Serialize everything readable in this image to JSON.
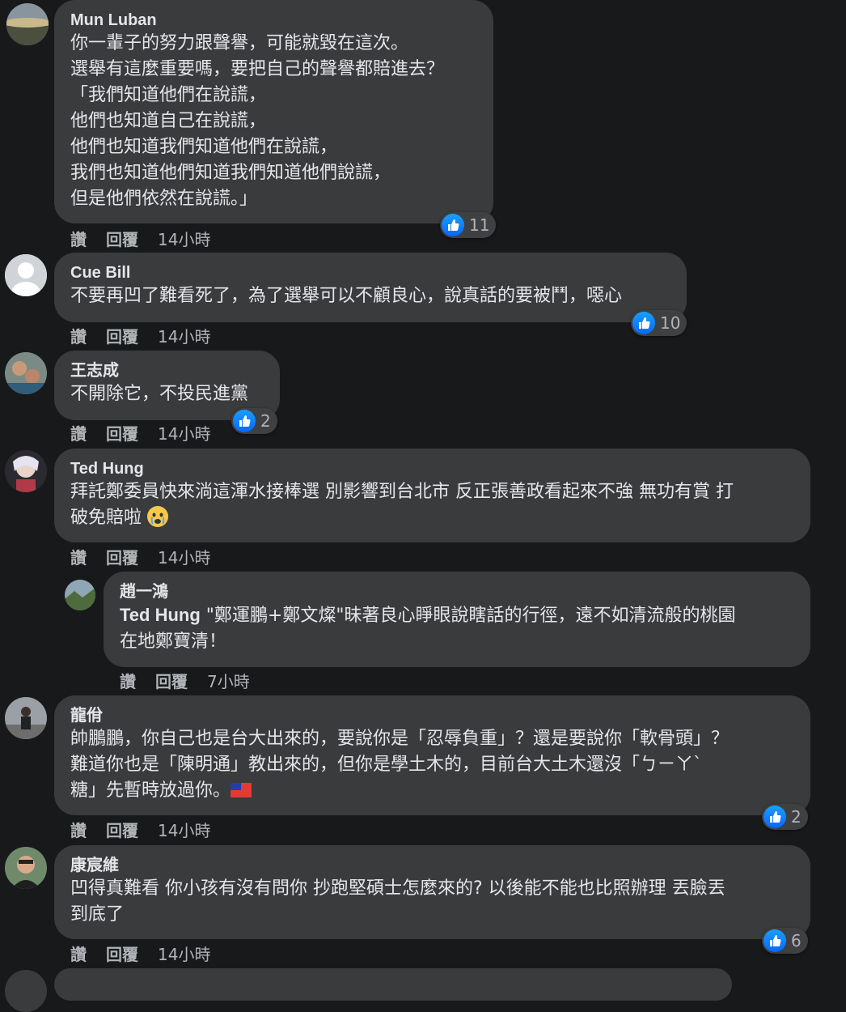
{
  "actions": {
    "like": "讚",
    "reply": "回覆"
  },
  "comments": [
    {
      "author": "Mun Luban",
      "lines": [
        "你一輩子的努力跟聲譽，可能就毀在這次。",
        "選舉有這麼重要嗎，要把自己的聲譽都賠進去？",
        "「我們知道他們在說謊，",
        "他們也知道自己在說謊，",
        "他們也知道我們知道他們在說謊，",
        "我們也知道他們知道我們知道他們說謊，",
        "但是他們依然在說謊。」"
      ],
      "reactions": "11",
      "time": "14小時"
    },
    {
      "author": "Cue Bill",
      "lines": [
        "不要再凹了難看死了，為了選舉可以不顧良心，說真話的要被鬥，噁心"
      ],
      "reactions": "10",
      "time": "14小時"
    },
    {
      "author": "王志成",
      "lines": [
        "不開除它，不投民進黨"
      ],
      "reactions": "2",
      "time": "14小時"
    },
    {
      "author": "Ted Hung",
      "lines": [
        "拜託鄭委員快來淌這渾水接棒選 別影響到台北市 反正張善政看起來不強 無功有賞 打",
        "破免賠啦"
      ],
      "emoji": "crying-face",
      "time": "14小時"
    },
    {
      "author": "趙一鴻",
      "mention": "Ted Hung",
      "lines": [
        " \"鄭運鵬+鄭文燦\"昧著良心睜眼說瞎話的行徑，遠不如清流般的桃園",
        "在地鄭寶清！"
      ],
      "time": "7小時"
    },
    {
      "author": "龍佾",
      "lines": [
        "帥鵬鵬，你自己也是台大出來的，要說你是「忍辱負重」？還是要說你「軟骨頭」？",
        "難道你也是「陳明通」教出來的，但你是學土木的，目前台大土木還沒「ㄅㄧㄚˋ",
        "糖」先暫時放過你。"
      ],
      "emoji": "taiwan-flag",
      "reactions": "2",
      "time": "14小時"
    },
    {
      "author": "康宸維",
      "lines": [
        "凹得真難看 你小孩有沒有問你 抄跑堅碩士怎麼來的? 以後能不能也比照辦理 丟臉丟",
        "到底了"
      ],
      "reactions": "6",
      "time": "14小時"
    }
  ],
  "colors": {
    "background": "#18191a",
    "bubble": "#3a3b3c",
    "like": "#0866ff",
    "meta": "#b0b3b8"
  }
}
